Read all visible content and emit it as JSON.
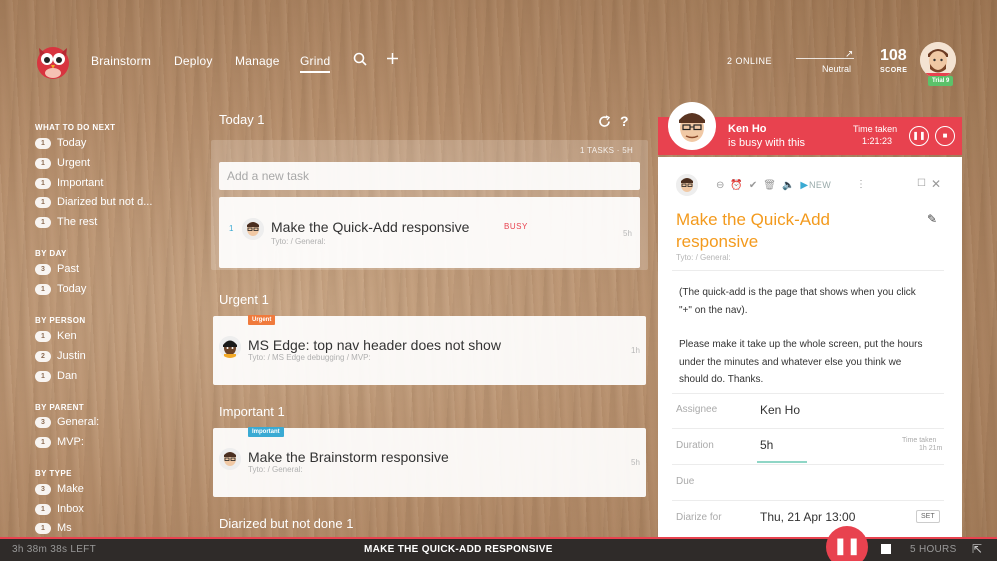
{
  "nav": {
    "items": [
      "Brainstorm",
      "Deploy",
      "Manage",
      "Grind"
    ],
    "active": "Grind",
    "search_icon": "search-icon",
    "add_icon": "plus-icon",
    "online": "2 ONLINE",
    "mood": "Neutral",
    "score": "108",
    "score_label": "SCORE",
    "trial": "Trial 9"
  },
  "sidebar": {
    "what_to_do": {
      "heading": "WHAT TO DO NEXT",
      "items": [
        {
          "count": "1",
          "label": "Today"
        },
        {
          "count": "1",
          "label": "Urgent"
        },
        {
          "count": "1",
          "label": "Important"
        },
        {
          "count": "1",
          "label": "Diarized but not d..."
        },
        {
          "count": "1",
          "label": "The rest"
        }
      ]
    },
    "by_day": {
      "heading": "BY DAY",
      "items": [
        {
          "count": "3",
          "label": "Past"
        },
        {
          "count": "1",
          "label": "Today"
        }
      ]
    },
    "by_person": {
      "heading": "BY PERSON",
      "items": [
        {
          "count": "1",
          "label": "Ken"
        },
        {
          "count": "2",
          "label": "Justin"
        },
        {
          "count": "1",
          "label": "Dan"
        }
      ]
    },
    "by_parent": {
      "heading": "BY PARENT",
      "items": [
        {
          "count": "3",
          "label": "General:"
        },
        {
          "count": "1",
          "label": "MVP:"
        }
      ]
    },
    "by_type": {
      "heading": "BY TYPE",
      "items": [
        {
          "count": "3",
          "label": "Make"
        },
        {
          "count": "1",
          "label": "Inbox"
        },
        {
          "count": "1",
          "label": "Ms"
        }
      ]
    }
  },
  "main": {
    "today": {
      "title": "Today 1",
      "meta": "1 TASKS · 5H",
      "add_placeholder": "Add a new task",
      "task": {
        "index": "1",
        "title": "Make the Quick-Add responsive",
        "status": "BUSY",
        "sub": "Tyto: / General:",
        "duration": "5h"
      }
    },
    "urgent": {
      "title": "Urgent 1",
      "task": {
        "tag": "Urgent",
        "title": "MS Edge: top nav header does not show",
        "sub": "Tyto: / MS Edge debugging / MVP:",
        "duration": "1h"
      }
    },
    "important": {
      "title": "Important 1",
      "task": {
        "tag": "Important",
        "title": "Make the Brainstorm responsive",
        "sub": "Tyto: / General:",
        "duration": "5h"
      }
    },
    "diarized": {
      "title": "Diarized but not done 1"
    }
  },
  "busy": {
    "name": "Ken Ho",
    "status": "is busy with this",
    "time_label": "Time taken",
    "time_value": "1:21:23"
  },
  "detail": {
    "new_label": "NEW",
    "title": "Make the Quick-Add responsive",
    "sub": "Tyto: / General:",
    "desc1": "(The quick-add is the page that shows when you click \"+\" on the nav).",
    "desc2": "Please make it take up the whole screen, put the hours under the minutes and whatever else you think we should do. Thanks.",
    "assignee_label": "Assignee",
    "assignee": "Ken Ho",
    "duration_label": "Duration",
    "duration": "5h",
    "time_taken_label": "Time taken",
    "time_taken_value": "1h 21m",
    "due_label": "Due",
    "diarize_label": "Diarize for",
    "diarize_value": "Thu, 21 Apr 13:00",
    "set_label": "SET"
  },
  "bottom": {
    "left": "3h 38m 38s LEFT",
    "center": "MAKE THE QUICK-ADD RESPONSIVE",
    "hours": "5 HOURS"
  },
  "colors": {
    "accent_red": "#e8424f",
    "title_orange": "#f39a1d",
    "urgent_tag": "#f07a3c",
    "important_tag": "#3aaad3",
    "trial_green": "#5cc26a"
  }
}
